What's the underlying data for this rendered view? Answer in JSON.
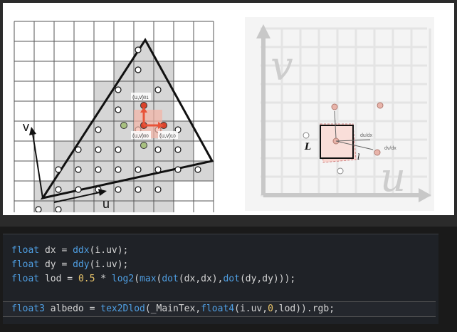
{
  "left": {
    "label_v": "v",
    "label_u": "u",
    "label_uv": "(u,v)",
    "sub_00": "00",
    "sub_10": "10",
    "sub_01": "01"
  },
  "right": {
    "label_v": "v",
    "label_u": "u",
    "label_L": "L",
    "label_l": "l",
    "label_dudx": "du/dx",
    "label_dvdx": "dv/dx"
  },
  "code": {
    "lines": [
      [
        [
          "kw",
          "float"
        ],
        [
          "t",
          " dx = "
        ],
        [
          "fn",
          "ddx"
        ],
        [
          "t",
          "(i.uv);"
        ]
      ],
      [
        [
          "kw",
          "float"
        ],
        [
          "t",
          " dy = "
        ],
        [
          "fn",
          "ddy"
        ],
        [
          "t",
          "(i.uv);"
        ]
      ],
      [
        [
          "kw",
          "float"
        ],
        [
          "t",
          " lod = "
        ],
        [
          "num",
          "0.5"
        ],
        [
          "t",
          " * "
        ],
        [
          "fn",
          "log2"
        ],
        [
          "t",
          "("
        ],
        [
          "fn",
          "max"
        ],
        [
          "t",
          "("
        ],
        [
          "fn",
          "dot"
        ],
        [
          "t",
          "(dx,dx),"
        ],
        [
          "fn",
          "dot"
        ],
        [
          "t",
          "(dy,dy)));"
        ]
      ],
      [
        [
          "kw",
          "float3"
        ],
        [
          "t",
          " albedo = "
        ],
        [
          "fn",
          "tex2Dlod"
        ],
        [
          "t",
          "(_MainTex,"
        ],
        [
          "kw",
          "float4"
        ],
        [
          "t",
          "(i.uv,"
        ],
        [
          "num",
          "0"
        ],
        [
          "t",
          ",lod)).rgb;"
        ]
      ]
    ]
  },
  "colors": {
    "keyword": "#4f9fe3",
    "number": "#e8c46a",
    "text": "#d4d4d4",
    "highlight": "#e8543a",
    "green_sample": "#a8c080"
  }
}
